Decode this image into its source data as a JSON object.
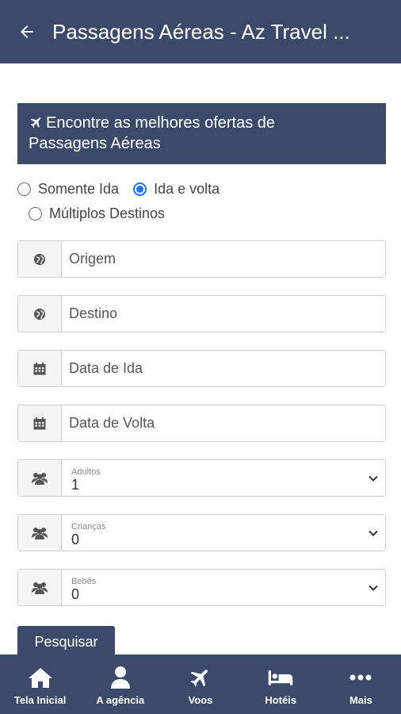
{
  "header": {
    "title": "Passagens Aéreas - Az Travel ..."
  },
  "banner": {
    "line1": "Encontre as melhores ofertas de",
    "line2": "Passagens Aéreas"
  },
  "trip_type": {
    "options": [
      "Somente Ida",
      "Ida e volta",
      "Múltiplos Destinos"
    ],
    "selected": "Ida e volta"
  },
  "form": {
    "origin_placeholder": "Origem",
    "destination_placeholder": "Destino",
    "departure_placeholder": "Data de Ida",
    "return_placeholder": "Data de Volta",
    "adults": {
      "label": "Adultos",
      "value": "1"
    },
    "children": {
      "label": "Crianças",
      "value": "0"
    },
    "babies": {
      "label": "Bebês",
      "value": "0"
    },
    "search_label": "Pesquisar"
  },
  "nav": {
    "items": [
      {
        "label": "Tela Inicial",
        "icon": "home-icon"
      },
      {
        "label": "A agência",
        "icon": "user-icon"
      },
      {
        "label": "Voos",
        "icon": "plane-icon"
      },
      {
        "label": "Hotéis",
        "icon": "bed-icon"
      },
      {
        "label": "Mais",
        "icon": "more-icon"
      }
    ]
  },
  "colors": {
    "primary": "#3b4a6b",
    "radio_accent": "#1a73e8"
  }
}
